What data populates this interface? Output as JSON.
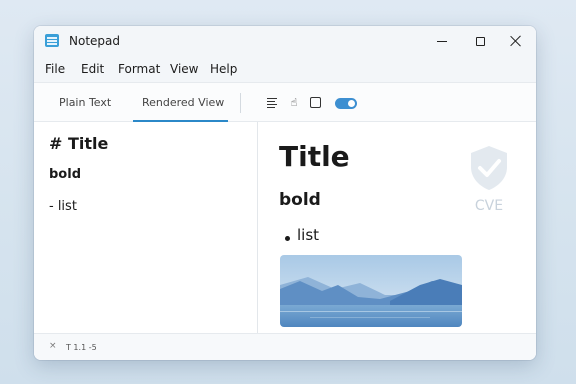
{
  "window": {
    "title": "Notepad"
  },
  "menu": {
    "items": [
      "File",
      "Edit",
      "Format",
      "View",
      "Help"
    ]
  },
  "tabs": [
    {
      "label": "Plain Text",
      "active": false
    },
    {
      "label": "Rendered View",
      "active": true
    }
  ],
  "toolbar": {
    "icons": [
      "align-lines-icon",
      "hand-pointer-icon",
      "square-icon",
      "toggle-switch"
    ],
    "toggle_on": true
  },
  "editor": {
    "lines": [
      "# Title",
      "bold",
      "- list"
    ]
  },
  "preview": {
    "heading": "Title",
    "bold_text": "bold",
    "list_items": [
      "list"
    ],
    "image": "mountain-lake-image",
    "watermark": "CVE"
  },
  "status": {
    "close_glyph": "×",
    "text": "T 1.1 -5"
  },
  "colors": {
    "accent": "#2b88c8",
    "toggle": "#3d8fd1",
    "app_icon": "#3a9fd8",
    "watermark": "#c8d2dc"
  }
}
